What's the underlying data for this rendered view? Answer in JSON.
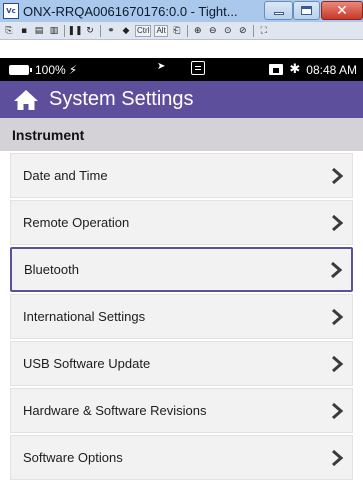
{
  "window": {
    "title": "ONX-RRQA0061670176:0.0 - Tight...",
    "icon": "vnc-icon",
    "controls": [
      "minimize",
      "maximize",
      "close"
    ]
  },
  "toolbar": {
    "ctrl_label": "Ctrl",
    "alt_label": "Alt"
  },
  "status_bar": {
    "battery": "100%",
    "time": "08:48 AM"
  },
  "header": {
    "title": "System Settings",
    "accent_color": "#5e4f9c"
  },
  "section": {
    "title": "Instrument"
  },
  "menu": {
    "items": [
      {
        "label": "Date and Time"
      },
      {
        "label": "Remote Operation"
      },
      {
        "label": "Bluetooth"
      },
      {
        "label": "International Settings"
      },
      {
        "label": "USB Software Update"
      },
      {
        "label": "Hardware & Software Revisions"
      },
      {
        "label": "Software Options"
      }
    ]
  }
}
